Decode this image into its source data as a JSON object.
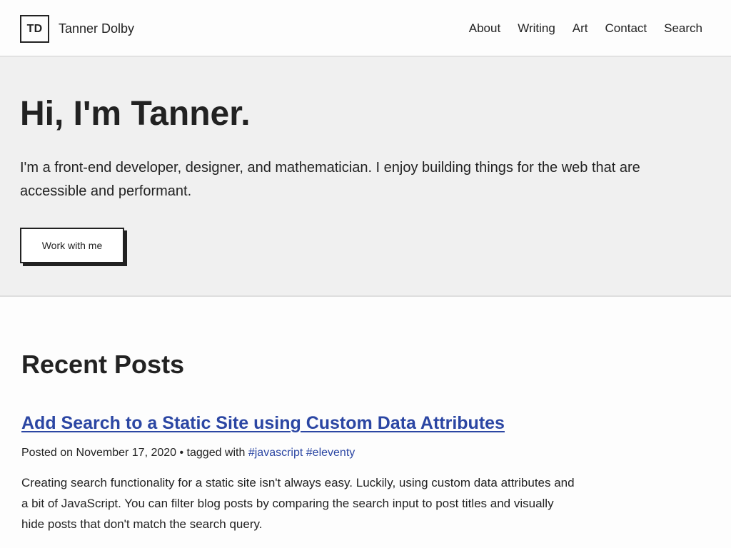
{
  "header": {
    "logo_text": "TD",
    "site_name": "Tanner Dolby",
    "nav": [
      {
        "label": "About"
      },
      {
        "label": "Writing"
      },
      {
        "label": "Art"
      },
      {
        "label": "Contact"
      },
      {
        "label": "Search"
      }
    ]
  },
  "hero": {
    "title": "Hi, I'm Tanner.",
    "text": "I'm a front-end developer, designer, and mathematician. I enjoy building things for the web that are accessible and performant.",
    "cta_label": "Work with me"
  },
  "recent": {
    "heading": "Recent Posts",
    "posts": [
      {
        "title": "Add Search to a Static Site using Custom Data Attributes",
        "meta_prefix": "Posted on",
        "date": "November 17, 2020",
        "meta_separator": "• tagged with",
        "tags": [
          "#javascript",
          "#eleventy"
        ],
        "excerpt": "Creating search functionality for a static site isn't always easy. Luckily, using custom data attributes and a bit of JavaScript. You can filter blog posts by comparing the search input to post titles and visually hide posts that don't match the search query."
      }
    ]
  },
  "colors": {
    "link": "#2b46a3",
    "text": "#222222",
    "hero_background": "#f0f0f0",
    "page_background": "#fdfdfd"
  }
}
